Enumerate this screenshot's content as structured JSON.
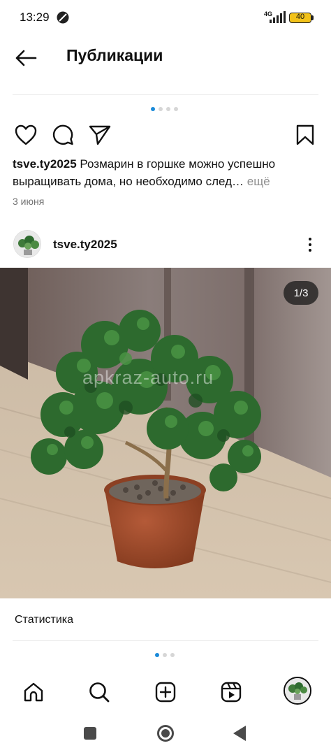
{
  "status_bar": {
    "time": "13:29",
    "network": "4G",
    "battery": "40"
  },
  "header": {
    "title": "Публикации",
    "back_icon": "arrow-left-icon"
  },
  "actions": {
    "like_icon": "heart-icon",
    "comment_icon": "comment-icon",
    "share_icon": "paper-plane-icon",
    "save_icon": "bookmark-icon"
  },
  "post": {
    "username": "tsve.ty2025",
    "caption": "Розмарин в горшке можно успешно выращивать дома, но необходимо след…",
    "more_label": "ещё",
    "date": "3 июня"
  },
  "next_post": {
    "author": "tsve.ty2025",
    "image_counter": "1/3",
    "watermark": "apkraz-auto.ru",
    "stats_label": "Статистика"
  },
  "carousel": {
    "top_total": 4,
    "top_active": 0,
    "bottom_total": 3,
    "bottom_active": 0
  },
  "bottom_nav": {
    "items": [
      "home-icon",
      "search-icon",
      "create-icon",
      "reels-icon",
      "profile-avatar"
    ]
  },
  "colors": {
    "accent": "#1a8ad9",
    "battery": "#f2c21a"
  }
}
